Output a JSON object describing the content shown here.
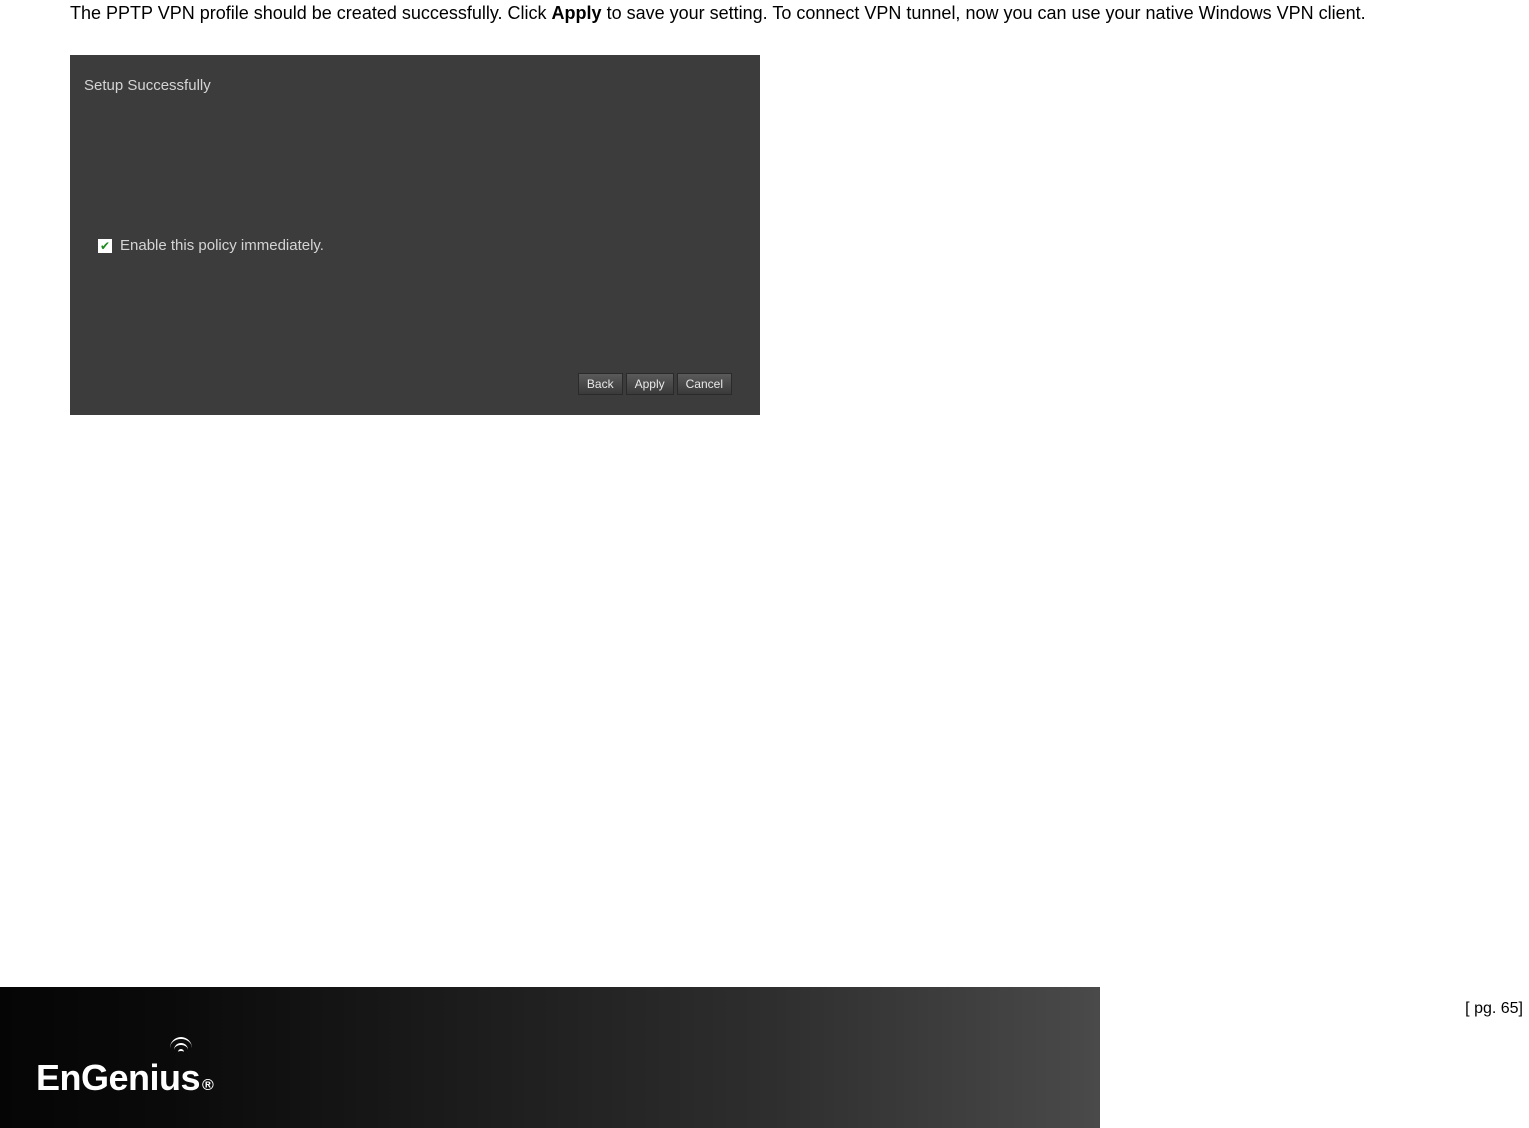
{
  "intro": {
    "text_before_bold": "The PPTP VPN profile should be created successfully. Click ",
    "bold_word": "Apply",
    "text_after_bold": " to save your setting. To connect VPN tunnel, now you can use your native Windows VPN client."
  },
  "panel": {
    "title": "Setup Successfully",
    "checkbox_label": "Enable this policy immediately.",
    "buttons": {
      "back": "Back",
      "apply": "Apply",
      "cancel": "Cancel"
    }
  },
  "footer": {
    "logo_text": "EnGenius",
    "registered": "®"
  },
  "page_number": "[ pg. 65]"
}
